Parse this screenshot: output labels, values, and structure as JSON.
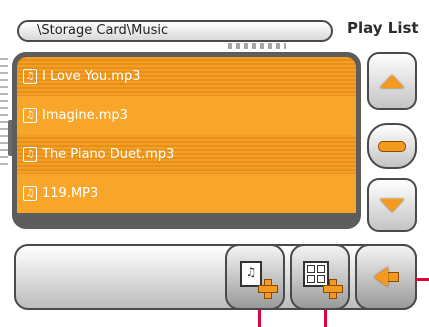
{
  "header": {
    "path": "\\Storage Card\\Music",
    "title": "Play List"
  },
  "playlist": {
    "items": [
      {
        "label": "I Love You.mp3"
      },
      {
        "label": "Imagine.mp3"
      },
      {
        "label": "The Piano Duet.mp3"
      },
      {
        "label": "119.MP3"
      }
    ]
  },
  "icons": {
    "scroll_up": "arrow-up-icon",
    "scroll_middle": "minus-icon",
    "scroll_down": "arrow-down-icon",
    "add_file": "add-music-file-icon",
    "add_folder": "add-folder-icon",
    "back": "back-arrow-icon",
    "track": "music-note-icon"
  },
  "colors": {
    "accent": "#f39a1f",
    "marker": "#e0003c"
  }
}
